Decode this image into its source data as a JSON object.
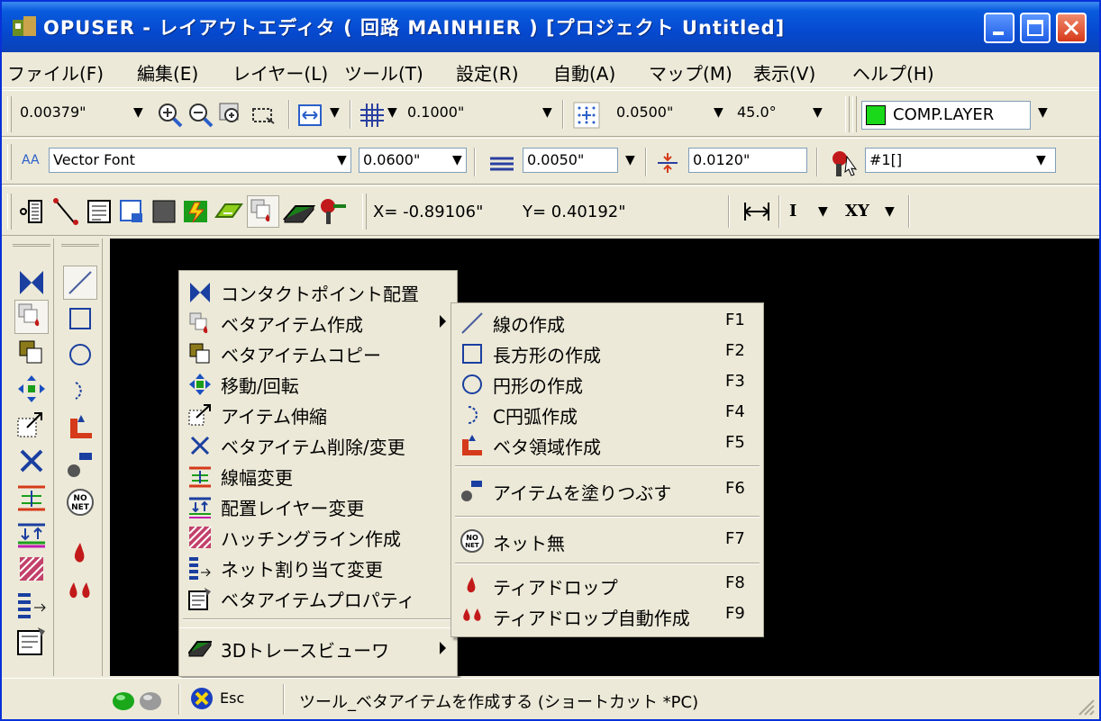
{
  "window": {
    "title": "OPUSER - レイアウトエディタ ( 回路 MAINHIER ) [プロジェクト Untitled]"
  },
  "menubar": {
    "items": [
      "ファイル(F)",
      "編集(E)",
      "レイヤー(L)",
      "ツール(T)",
      "設定(R)",
      "自動(A)",
      "マップ(M)",
      "表示(V)",
      "ヘルプ(H)"
    ]
  },
  "toolbar1": {
    "zoom_value": "0.00379\"",
    "grid_value": "0.1000\"",
    "snap_value": "0.0500\"",
    "angle_value": "45.0°",
    "layer_value": "COMP.LAYER",
    "layer_color": "#1ad81a"
  },
  "toolbar2": {
    "font_value": "Vector Font",
    "text_size": "0.0600\"",
    "line_width": "0.0050\"",
    "clearance": "0.0120\"",
    "net_value": "#1[]"
  },
  "toolbar3": {
    "x_coord": "X= -0.89106\"",
    "y_coord": "Y= 0.40192\"",
    "mode_i": "I",
    "mode_xy": "XY"
  },
  "main_menu": {
    "items": [
      {
        "label": "コンタクトポイント配置",
        "icon": "contact-point-icon"
      },
      {
        "label": "ベタアイテム作成",
        "icon": "solid-item-icon",
        "submenu": true
      },
      {
        "label": "ベタアイテムコピー",
        "icon": "copy-icon"
      },
      {
        "label": "移動/回転",
        "icon": "move-icon"
      },
      {
        "label": "アイテム伸縮",
        "icon": "stretch-icon"
      },
      {
        "label": "ベタアイテム削除/変更",
        "icon": "delete-icon"
      },
      {
        "label": "線幅変更",
        "icon": "line-width-icon"
      },
      {
        "label": "配置レイヤー変更",
        "icon": "layer-change-icon"
      },
      {
        "label": "ハッチングライン作成",
        "icon": "hatching-icon"
      },
      {
        "label": "ネット割り当て変更",
        "icon": "net-assign-icon"
      },
      {
        "label": "ベタアイテムプロパティ",
        "icon": "properties-icon"
      },
      {
        "label": "3Dトレースビューワ",
        "icon": "3d-viewer-icon",
        "submenu": true
      }
    ]
  },
  "sub_menu": {
    "items": [
      {
        "label": "線の作成",
        "key": "F1",
        "icon": "line-icon"
      },
      {
        "label": "長方形の作成",
        "key": "F2",
        "icon": "rectangle-icon"
      },
      {
        "label": "円形の作成",
        "key": "F3",
        "icon": "circle-icon"
      },
      {
        "label": "C円弧作成",
        "key": "F4",
        "icon": "arc-icon"
      },
      {
        "label": "ベタ領域作成",
        "key": "F5",
        "icon": "area-icon"
      },
      {
        "label": "アイテムを塗りつぶす",
        "key": "F6",
        "icon": "fill-icon"
      },
      {
        "label": "ネット無",
        "key": "F7",
        "icon": "no-net-icon"
      },
      {
        "label": "ティアドロップ",
        "key": "F8",
        "icon": "teardrop-icon"
      },
      {
        "label": "ティアドロップ自動作成",
        "key": "F9",
        "icon": "teardrop-auto-icon"
      }
    ]
  },
  "statusbar": {
    "esc_label": "Esc",
    "message": "ツール_ベタアイテムを作成する (ショートカット *PC)"
  }
}
